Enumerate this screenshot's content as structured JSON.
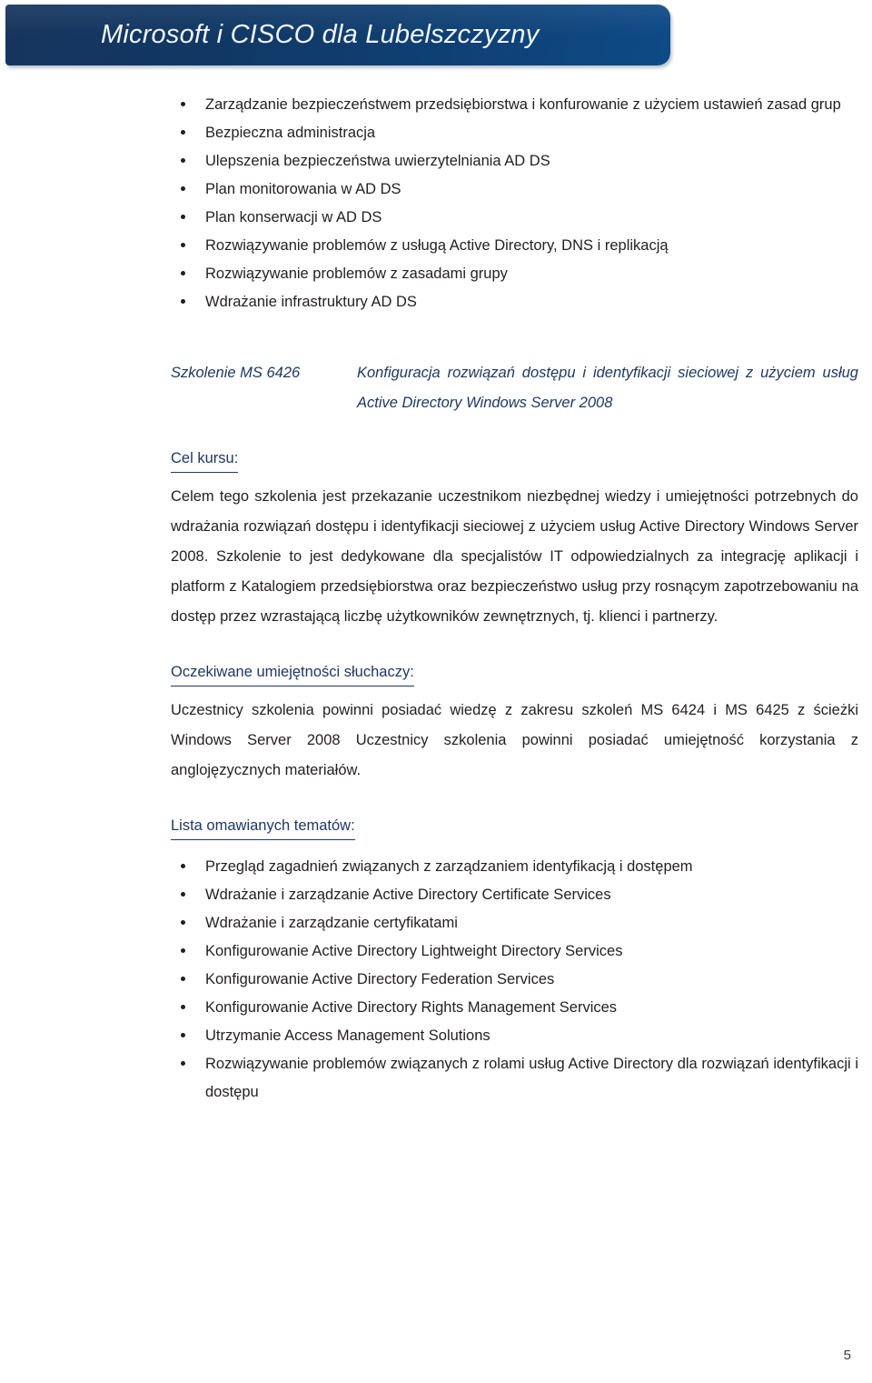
{
  "header": {
    "title": "Microsoft i CISCO dla Lubelszczyzny",
    "accent_color": "#0f3f72"
  },
  "top_list": {
    "items": [
      "Zarządzanie bezpieczeństwem przedsiębiorstwa i konfurowanie z użyciem ustawień zasad grup",
      "Bezpieczna administracja",
      "Ulepszenia bezpieczeństwa uwierzytelniania AD DS",
      "Plan monitorowania w AD DS",
      "Plan konserwacji w AD DS",
      "Rozwiązywanie problemów z usługą Active Directory, DNS i replikacją",
      "Rozwiązywanie problemów z zasadami grupy",
      "Wdrażanie infrastruktury AD DS"
    ]
  },
  "course": {
    "code_label": "Szkolenie MS 6426",
    "title": "Konfiguracja rozwiązań dostępu i identyfikacji sieciowej z użyciem usług Active Directory Windows Server 2008",
    "heading_color": "#1f3864"
  },
  "goal_section": {
    "heading": "Cel kursu:",
    "paragraph": "Celem tego szkolenia jest przekazanie uczestnikom niezbędnej wiedzy i umiejętności potrzebnych do wdrażania rozwiązań dostępu i identyfikacji  sieciowej z użyciem usług  Active Directory  Windows Server 2008. Szkolenie to jest dedykowane dla specjalistów IT odpowiedzialnych za integrację aplikacji i platform z Katalogiem przedsiębiorstwa oraz bezpieczeństwo usług przy rosnącym  zapotrzebowaniu na dostęp przez wzrastającą liczbę użytkowników zewnętrznych, tj. klienci i partnerzy."
  },
  "skills_section": {
    "heading": "Oczekiwane umiejętności słuchaczy:",
    "paragraph": "Uczestnicy szkolenia powinni posiadać wiedzę z zakresu szkoleń MS 6424 i MS 6425 z ścieżki  Windows Server 2008 Uczestnicy szkolenia powinni posiadać umiejętność korzystania z anglojęzycznych materiałów."
  },
  "topics_section": {
    "heading": "Lista omawianych tematów:",
    "items": [
      "Przegląd zagadnień związanych z zarządzaniem identyfikacją i dostępem",
      "Wdrażanie i zarządzanie Active Directory Certificate Services",
      "Wdrażanie i zarządzanie certyfikatami",
      "Konfigurowanie Active Directory Lightweight Directory Services",
      "Konfigurowanie Active Directory Federation Services",
      "Konfigurowanie Active Directory Rights Management Services",
      "Utrzymanie  Access Management Solutions",
      "Rozwiązywanie problemów związanych z rolami usług Active Directory dla rozwiązań identyfikacji i dostępu"
    ]
  },
  "footer": {
    "page_number": "5"
  }
}
